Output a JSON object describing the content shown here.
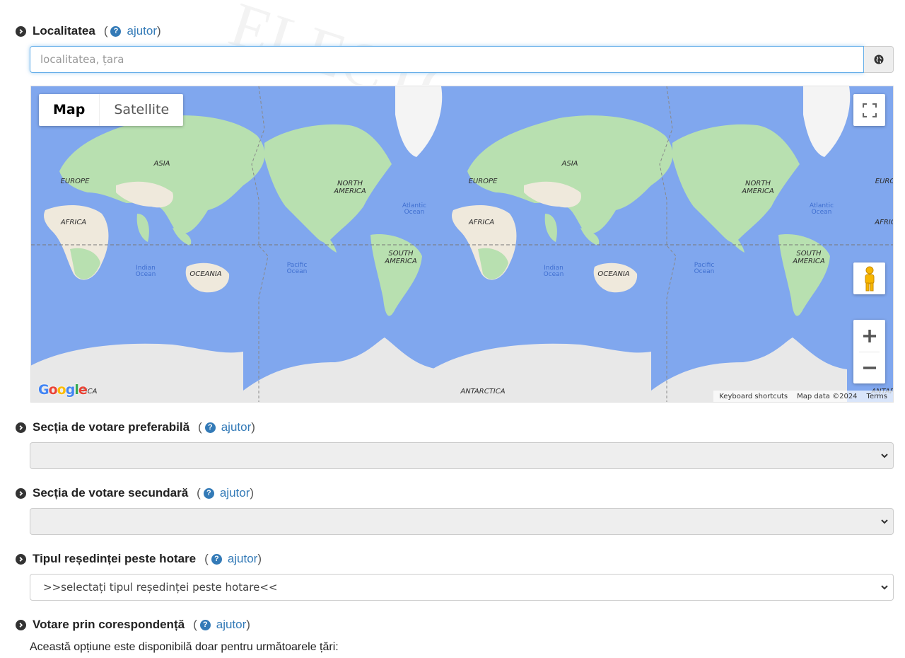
{
  "locality": {
    "label": "Localitatea",
    "help_open": "(",
    "help_text": "ajutor",
    "help_close": ")",
    "input_value": "",
    "input_placeholder": "localitatea, țara",
    "addon_icon": "globe-icon"
  },
  "map": {
    "type_map": "Map",
    "type_satellite": "Satellite",
    "labels": {
      "asia": "ASIA",
      "europe": "EUROPE",
      "africa": "AFRICA",
      "north_america": "NORTH",
      "north_america_2": "AMERICA",
      "south_america": "SOUTH",
      "south_america_2": "AMERICA",
      "oceania": "OCEANIA",
      "antarctica": "ANTARCTICA",
      "antarctica_partial_left": "TICA",
      "antarctica_partial_right": "ANTAR",
      "europe_partial": "EURO",
      "africa_partial": "AFRIC",
      "atlantic": "Atlantic",
      "atlantic_2": "Ocean",
      "indian": "Indian",
      "indian_2": "Ocean",
      "pacific": "Pacific",
      "pacific_2": "Ocean"
    },
    "google_logo": "Google",
    "keyboard_shortcuts": "Keyboard shortcuts",
    "map_data": "Map data ©2024",
    "terms": "Terms",
    "colors": {
      "water": "#80a7ee",
      "land": "#b8e0b0",
      "desert": "#efe9dc",
      "ice": "#e8e8e8"
    }
  },
  "primary_station": {
    "label": "Secția de votare preferabilă",
    "help_open": "(",
    "help_text": "ajutor",
    "help_close": ")",
    "value": ""
  },
  "secondary_station": {
    "label": "Secția de votare secundară",
    "help_open": "(",
    "help_text": "ajutor",
    "help_close": ")",
    "value": ""
  },
  "residence": {
    "label": "Tipul reședinței peste hotare",
    "help_open": "(",
    "help_text": "ajutor",
    "help_close": ")",
    "value": ">>selectați tipul reședinței peste hotare<<"
  },
  "mail_vote": {
    "label": "Votare prin corespondență",
    "help_open": "(",
    "help_text": "ajutor",
    "help_close": ")",
    "note": "Această opțiune este disponibilă doar pentru următoarele țări:"
  }
}
